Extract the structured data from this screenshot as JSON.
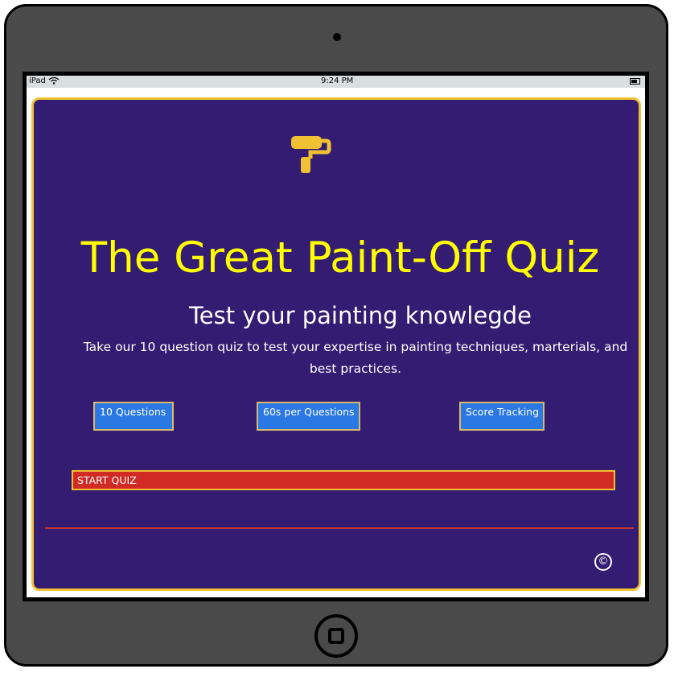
{
  "statusbar": {
    "carrier": "iPad",
    "time": "9:24 PM",
    "wifi_icon": "wifi-icon",
    "battery_icon": "battery-icon"
  },
  "page": {
    "logo_icon": "paint-roller-icon",
    "title": "The Great Paint-Off Quiz",
    "subtitle": "Test your painting knowlegde",
    "description": "Take our 10 question quiz to test your expertise in painting techniques, marterials, and best practices.",
    "features": [
      "10 Questions",
      "60s per Questions",
      "Score Tracking"
    ],
    "start_label": "START QUIZ",
    "copyright_symbol": "©"
  },
  "colors": {
    "background": "#331c72",
    "border": "#f0c233",
    "title": "#ffff00",
    "feature_bg": "#2a78e4",
    "start_bg": "#d22b26",
    "divider": "#c0322c"
  }
}
